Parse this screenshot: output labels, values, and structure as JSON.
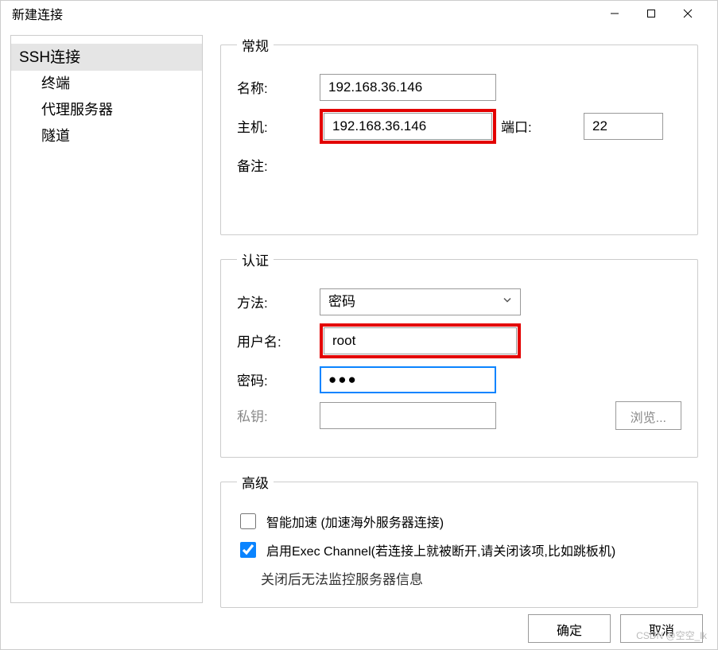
{
  "window": {
    "title": "新建连接"
  },
  "sidebar": {
    "root": "SSH连接",
    "items": [
      "终端",
      "代理服务器",
      "隧道"
    ]
  },
  "general": {
    "legend": "常规",
    "name_label": "名称:",
    "name_value": "192.168.36.146",
    "host_label": "主机:",
    "host_value": "192.168.36.146",
    "port_label": "端口:",
    "port_value": "22",
    "remark_label": "备注:",
    "remark_value": ""
  },
  "auth": {
    "legend": "认证",
    "method_label": "方法:",
    "method_value": "密码",
    "user_label": "用户名:",
    "user_value": "root",
    "pw_label": "密码:",
    "pw_display": "●●●",
    "key_label": "私钥:",
    "key_value": "",
    "browse_label": "浏览..."
  },
  "advanced": {
    "legend": "高级",
    "accel_label": "智能加速 (加速海外服务器连接)",
    "accel_checked": false,
    "exec_label": "启用Exec Channel(若连接上就被断开,请关闭该项,比如跳板机)",
    "exec_checked": true,
    "exec_hint": "关闭后无法监控服务器信息"
  },
  "footer": {
    "ok": "确定",
    "cancel": "取消"
  },
  "watermark": "CSDN @空空_lk"
}
